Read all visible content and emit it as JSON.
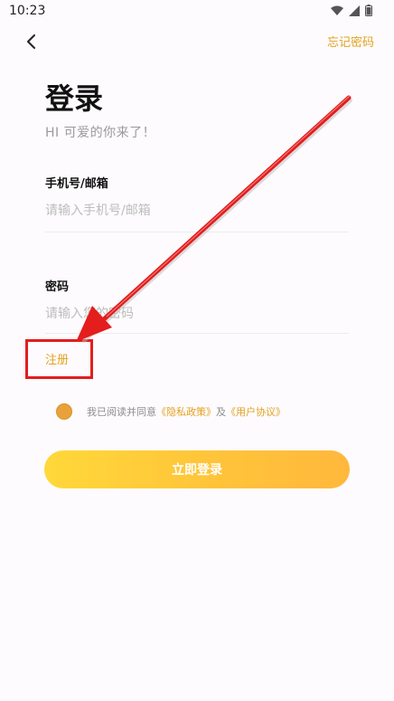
{
  "status_bar": {
    "time": "10:23",
    "icons": [
      "wifi-icon",
      "signal-icon",
      "battery-icon"
    ]
  },
  "header": {
    "back_icon": "back-chevron-icon",
    "forgot_password": "忘记密码"
  },
  "page": {
    "title": "登录",
    "subtitle": "HI 可爱的你来了！"
  },
  "form": {
    "account": {
      "label": "手机号/邮箱",
      "placeholder": "请输入手机号/邮箱",
      "value": ""
    },
    "password": {
      "label": "密码",
      "placeholder": "请输入您的密码",
      "value": ""
    }
  },
  "register_link": "注册",
  "agreement": {
    "prefix": "我已阅读并同意",
    "privacy": "《隐私政策》",
    "conjunction": "及",
    "terms": "《用户协议》",
    "checked": true
  },
  "login_button": "立即登录",
  "colors": {
    "accent": "#e3a21f",
    "button_start": "#ffd83a",
    "button_end": "#ffb83c",
    "annotation": "#e41d1d"
  }
}
